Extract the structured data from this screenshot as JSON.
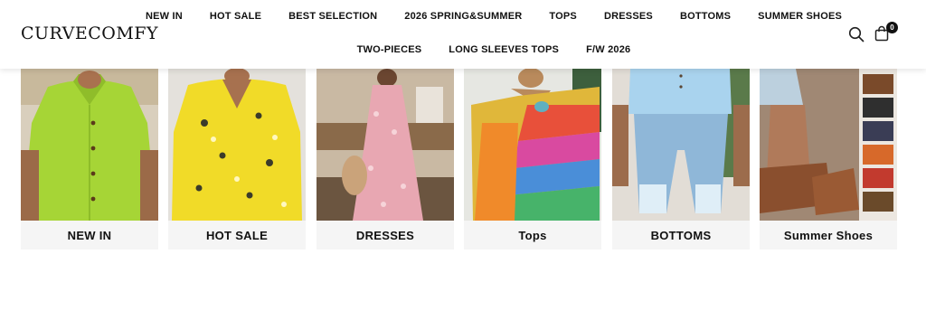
{
  "brand": {
    "logo_text": "CURVECOMFY"
  },
  "nav": {
    "row1": [
      "NEW IN",
      "HOT SALE",
      "BEST SELECTION",
      "2026 SPRING&SUMMER",
      "TOPS",
      "DRESSES",
      "BOTTOMS",
      "SUMMER SHOES"
    ],
    "row2": [
      "TWO-PIECES",
      "LONG SLEEVES TOPS",
      "F/W 2026"
    ]
  },
  "header_icons": {
    "search": "search-icon",
    "cart": "shopping-bag-icon",
    "cart_count": "0"
  },
  "categories": [
    {
      "label": "NEW IN",
      "image": "lime green button-up shirt"
    },
    {
      "label": "HOT SALE",
      "image": "yellow floral v-neck blouse"
    },
    {
      "label": "DRESSES",
      "image": "pink floral maxi dress"
    },
    {
      "label": "Tops",
      "image": "rainbow patchwork top"
    },
    {
      "label": "BOTTOMS",
      "image": "light blue capri leggings"
    },
    {
      "label": "Summer Shoes",
      "image": "brown sandals"
    }
  ],
  "colors": {
    "badge": "#111111",
    "label_bar": "#f4f4f4"
  }
}
